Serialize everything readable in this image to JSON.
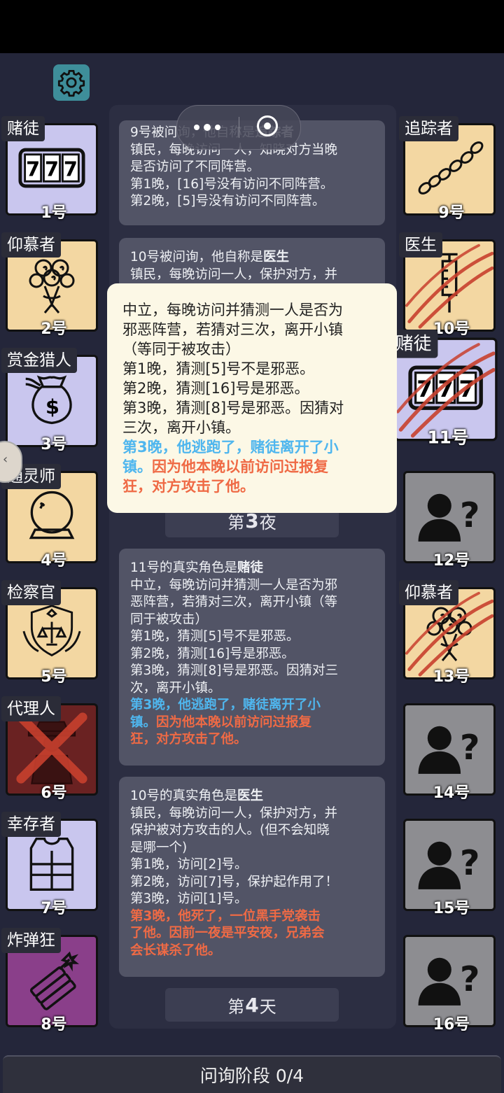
{
  "header": {
    "settings_icon": "gear-icon",
    "menu_icon": "more-dots-icon",
    "close_icon": "target-circle-icon"
  },
  "left_cards": [
    {
      "role": "赌徒",
      "number": "1号",
      "icon": "slot-777-icon",
      "bg": "#c9c6ee"
    },
    {
      "role": "仰慕者",
      "number": "2号",
      "icon": "roses-bouquet-icon",
      "bg": "#f3d7a2"
    },
    {
      "role": "赏金猎人",
      "number": "3号",
      "icon": "money-bag-icon",
      "bg": "#c9c6ee"
    },
    {
      "role": "通灵师",
      "number": "4号",
      "icon": "crystal-ball-icon",
      "bg": "#f3d7a2"
    },
    {
      "role": "检察官",
      "number": "5号",
      "icon": "justice-badge-icon",
      "bg": "#f3d7a2"
    },
    {
      "role": "代理人",
      "number": "6号",
      "icon": "agent-figure-icon",
      "bg": "#6a2222"
    },
    {
      "role": "幸存者",
      "number": "7号",
      "icon": "vest-icon",
      "bg": "#c9c6ee"
    },
    {
      "role": "炸弹狂",
      "number": "8号",
      "icon": "dynamite-icon",
      "bg": "#8a3f8a"
    }
  ],
  "right_cards": [
    {
      "role": "追踪者",
      "number": "9号",
      "icon": "footprints-icon",
      "bg": "#f3d7a2"
    },
    {
      "role": "医生",
      "number": "10号",
      "icon": "syringe-icon",
      "bg": "#f3d7a2"
    },
    {
      "role": "赌徒",
      "number": "11号",
      "icon": "slot-777-icon",
      "bg": "#c9c6ee"
    },
    {
      "role": "",
      "number": "12号",
      "icon": "unknown-user-icon",
      "bg": "#8d8d91"
    },
    {
      "role": "仰慕者",
      "number": "13号",
      "icon": "roses-bouquet-icon",
      "bg": "#f3d7a2"
    },
    {
      "role": "",
      "number": "14号",
      "icon": "unknown-user-icon",
      "bg": "#8d8d91"
    },
    {
      "role": "",
      "number": "15号",
      "icon": "unknown-user-icon",
      "bg": "#8d8d91"
    },
    {
      "role": "",
      "number": "16号",
      "icon": "unknown-user-icon",
      "bg": "#8d8d91"
    }
  ],
  "log": {
    "entry1": {
      "head": "9号被问询，他自称是",
      "role": "追踪者",
      "lines": [
        "镇民，每晚访问一人，知晓对方当晚",
        "是否访问了不同阵营。",
        "第1晚，[16]号没有访问不同阵营。",
        "第2晚，[5]号没有访问不同阵营。"
      ]
    },
    "entry2": {
      "head": "10号被问询，他自称是",
      "role": "医生",
      "lines": [
        "镇民，每晚访问一人，保护对方，并"
      ]
    },
    "night_label": {
      "prefix": "第",
      "num": "3",
      "suffix": "夜"
    },
    "entry3": {
      "head": "11号的真实角色是",
      "role": "赌徒",
      "lines": [
        "中立，每晚访问并猜测一人是否为邪",
        "恶阵营，若猜对三次，离开小镇（等",
        "同于被攻击）",
        "第1晚，猜测[5]号不是邪恶。",
        "第2晚，猜测[16]号是邪恶。",
        "第3晚，猜测[8]号是邪恶。因猜对三",
        "次，离开小镇。"
      ],
      "blue": [
        "第3晚，他逃跑了，赌徒离开了小",
        "镇。"
      ],
      "red_inline": "因为他本晚以前访问过报复",
      "red": [
        "狂，对方攻击了他。"
      ]
    },
    "entry4": {
      "head": "10号的真实角色是",
      "role": "医生",
      "lines": [
        "镇民，每晚访问一人，保护对方，并",
        "保护被对方攻击的人。(但不会知晓",
        "是哪一个)",
        "第1晚，访问[2]号。",
        "第2晚，访问[7]号，保护起作用了！",
        "第3晚，访问[1]号。"
      ],
      "red": [
        "第3晚，他死了，一位黑手党袭击",
        "了他。因前一夜是平安夜，兄弟会",
        "会长谋杀了他。"
      ]
    },
    "day_label": {
      "prefix": "第",
      "num": "4",
      "suffix": "天"
    }
  },
  "popup": {
    "lines": [
      "中立，每晚访问并猜测一人是否为",
      "邪恶阵营，若猜对三次，离开小镇",
      "（等同于被攻击）",
      "第1晚，猜测[5]号不是邪恶。",
      "第2晚，猜测[16]号是邪恶。",
      "第3晚，猜测[8]号是邪恶。因猜对",
      "三次，离开小镇。"
    ],
    "blue_line1": "第3晚，他逃跑了，赌徒离开了小",
    "blue_line2": "镇。",
    "red_inline": "因为他本晚以前访问过报复",
    "red_line": "狂，对方攻击了他。"
  },
  "bottom": {
    "phase": "问询阶段 0/4"
  },
  "colors": {
    "blue": "#4fb6ee",
    "red": "#ef6a45",
    "popup_bg": "#fcf8e6"
  }
}
